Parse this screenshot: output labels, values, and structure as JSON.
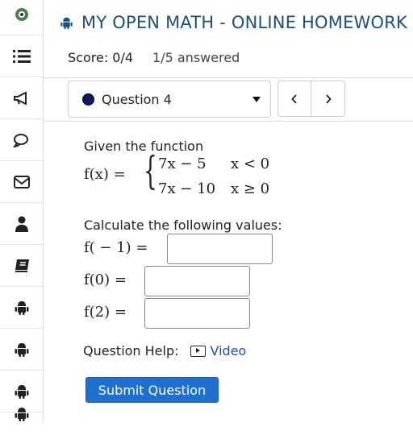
{
  "sidebar": {
    "items": [
      {
        "icon": "course-logo-icon"
      },
      {
        "icon": "list-icon"
      },
      {
        "icon": "megaphone-icon"
      },
      {
        "icon": "chat-icon"
      },
      {
        "icon": "mail-icon"
      },
      {
        "icon": "user-icon"
      },
      {
        "icon": "book-icon"
      },
      {
        "icon": "android-icon"
      },
      {
        "icon": "android-icon"
      },
      {
        "icon": "android-icon"
      },
      {
        "icon": "android-icon"
      }
    ]
  },
  "header": {
    "title": "MY OPEN MATH - ONLINE HOMEWORK",
    "score": "Score: 0/4",
    "answered": "1/5 answered"
  },
  "question_nav": {
    "selected": "Question 4",
    "status_color": "#0b1a6b",
    "prev": "‹",
    "next": "›"
  },
  "question": {
    "intro": "Given the function",
    "function_name": "f(x) =",
    "cases": [
      {
        "expr": "7x − 5",
        "cond": "x < 0"
      },
      {
        "expr": "7x − 10",
        "cond": "x ≥ 0"
      }
    ],
    "prompt": "Calculate the following values:",
    "answers": [
      {
        "label": "f( − 1) =",
        "value": ""
      },
      {
        "label": "f(0) =",
        "value": ""
      },
      {
        "label": "f(2) =",
        "value": ""
      }
    ],
    "help_label": "Question Help:",
    "video_label": "Video",
    "submit_label": "Submit Question"
  },
  "colors": {
    "title": "#1d4f7c",
    "submit_bg": "#1f6fcf",
    "link": "#1c4fb5"
  }
}
